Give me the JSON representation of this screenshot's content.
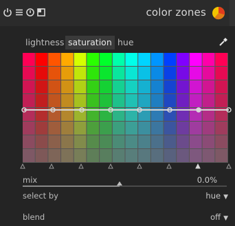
{
  "header": {
    "title": "color zones",
    "icons": [
      "power-icon",
      "presets-icon",
      "reset-icon",
      "multi-instance-icon",
      "color-ball-icon"
    ]
  },
  "tabs": [
    {
      "label": "lightness",
      "active": false
    },
    {
      "label": "saturation",
      "active": true
    },
    {
      "label": "hue",
      "active": false
    }
  ],
  "grid": {
    "columns": 16,
    "rows": 8,
    "hue_columns_deg": [
      340,
      0,
      20,
      40,
      70,
      110,
      130,
      160,
      175,
      190,
      205,
      225,
      270,
      300,
      320,
      340
    ],
    "row_saturation": [
      1.0,
      0.92,
      0.82,
      0.72,
      0.6,
      0.45,
      0.3,
      0.18
    ],
    "row_lightness": [
      0.5,
      0.47,
      0.45,
      0.44,
      0.44,
      0.43,
      0.42,
      0.42
    ]
  },
  "curve": {
    "type": "flat",
    "nodes": 8,
    "selected_node": 6
  },
  "mix": {
    "label": "mix",
    "value_text": "0.0%",
    "value": 0.0
  },
  "select_by": {
    "label": "select by",
    "value": "hue"
  },
  "blend": {
    "label": "blend",
    "value": "off"
  },
  "colors": {
    "header_bg": "#2b2b2b",
    "panel_bg": "#242424",
    "text": "#c8c8c8",
    "curve": "#d8d8d8"
  }
}
